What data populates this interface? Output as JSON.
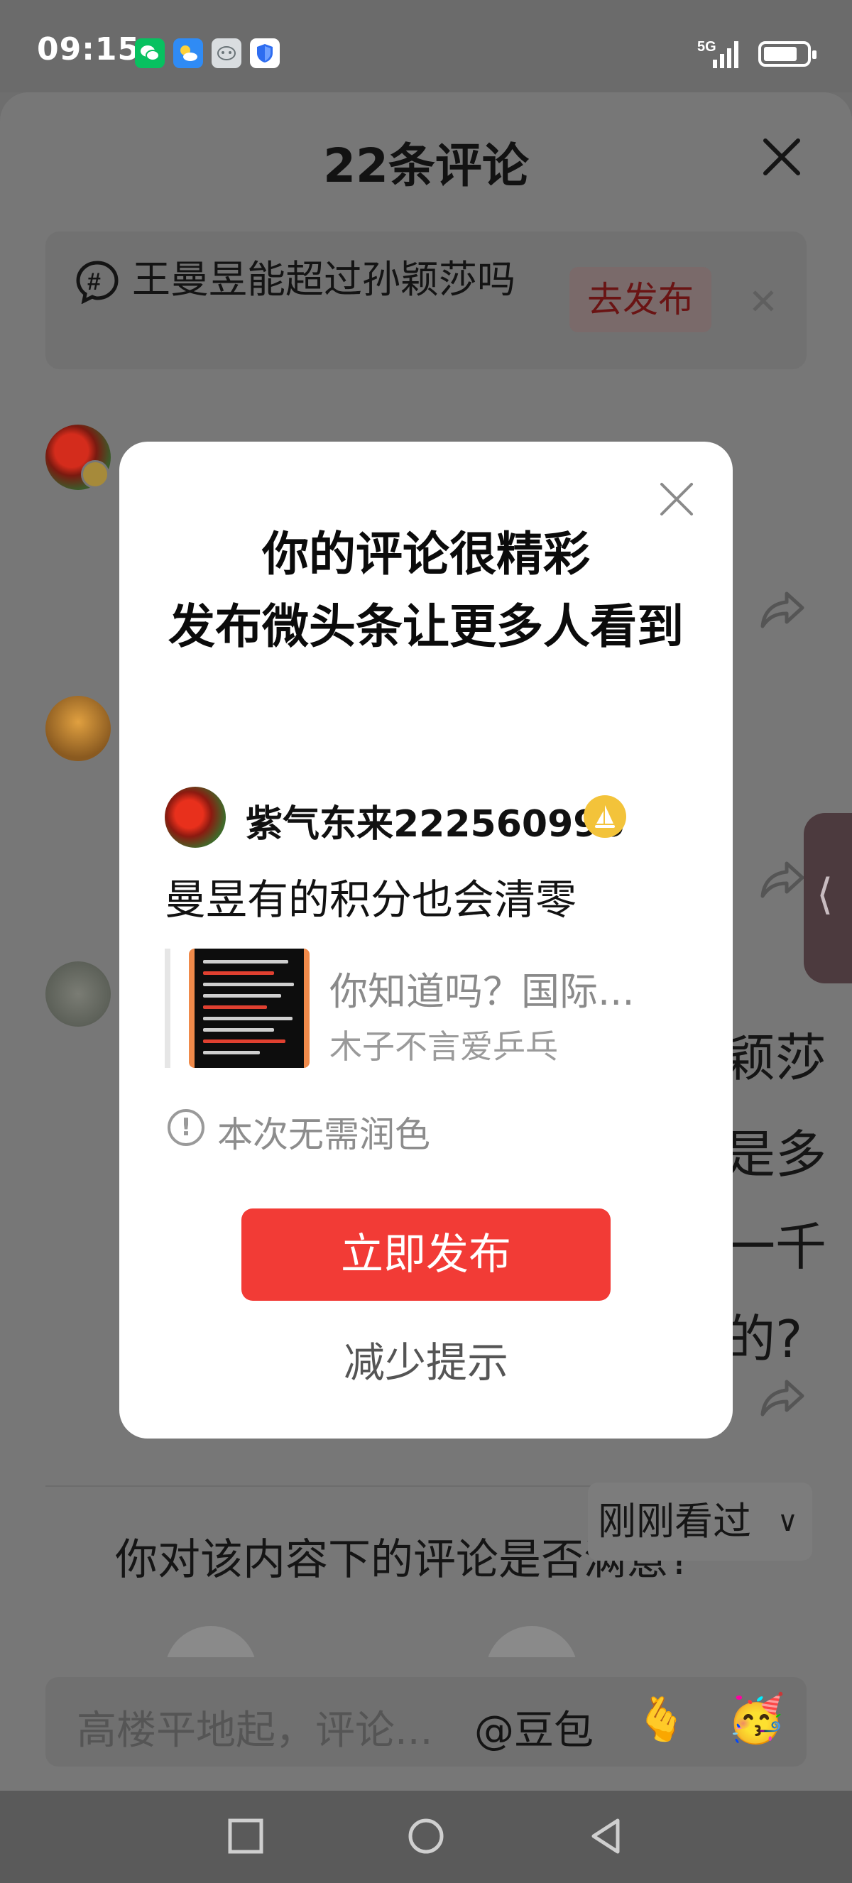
{
  "status_bar": {
    "time": "09:15",
    "network": "5G",
    "icons": [
      "wechat-icon",
      "weather-icon",
      "face-app-icon",
      "shield-icon",
      "signal-icon",
      "battery-icon"
    ]
  },
  "sheet": {
    "title": "22条评论",
    "topic_banner": {
      "text": "王曼昱能超过孙颖莎吗",
      "publish_label": "去发布"
    },
    "behind_text": [
      "颖莎",
      "是多",
      "一千",
      "的?"
    ],
    "survey_question": "你对该内容下的评论是否满意?",
    "recent_chip": "刚刚看过",
    "input_placeholder": "高楼平地起，评论...",
    "doubao_label": "@豆包"
  },
  "modal": {
    "title_line1": "你的评论很精彩",
    "title_line2": "发布微头条让更多人看到",
    "post": {
      "username": "紫气东来222560996",
      "comment": "曼昱有的积分也会清零",
      "quote_title": "你知道吗？国际...",
      "quote_author": "木子不言爱乒乓"
    },
    "hint": "本次无需润色",
    "publish_button": "立即发布",
    "reduce_link": "减少提示"
  },
  "colors": {
    "accent_red": "#f23b36",
    "dim_overlay": "#777777",
    "badge_gold": "#f3c33a"
  }
}
